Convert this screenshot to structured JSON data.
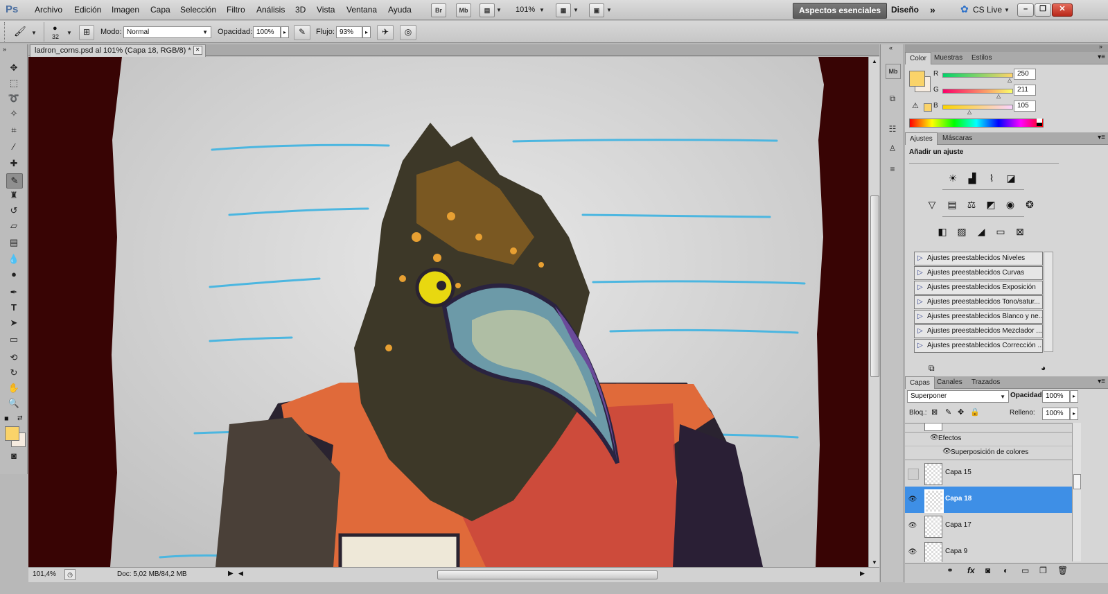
{
  "app": {
    "logo": "Ps"
  },
  "menu": [
    "Archivo",
    "Edición",
    "Imagen",
    "Capa",
    "Selección",
    "Filtro",
    "Análisis",
    "3D",
    "Vista",
    "Ventana",
    "Ayuda"
  ],
  "menubar": {
    "bridge": "Br",
    "minibridge": "Mb",
    "zoom": "101%",
    "workspace_active": "Aspectos esenciales",
    "workspace_other": "Diseño",
    "cs_live": "CS Live"
  },
  "options": {
    "brush_size": "32",
    "mode_label": "Modo:",
    "mode_value": "Normal",
    "opacity_label": "Opacidad:",
    "opacity_value": "100%",
    "flow_label": "Flujo:",
    "flow_value": "93%"
  },
  "document": {
    "tab_title": "ladron_corns.psd al 101% (Capa 18, RGB/8) *",
    "status_zoom": "101,4%",
    "status_doc": "Doc: 5,02 MB/84,2 MB"
  },
  "color_panel": {
    "tabs": [
      "Color",
      "Muestras",
      "Estilos"
    ],
    "fg_color": "#fad369",
    "channels": [
      {
        "label": "R",
        "value": "250"
      },
      {
        "label": "G",
        "value": "211"
      },
      {
        "label": "B",
        "value": "105"
      }
    ]
  },
  "adjustments_panel": {
    "tabs": [
      "Ajustes",
      "Máscaras"
    ],
    "title": "Añadir un ajuste",
    "presets": [
      "Ajustes preestablecidos Niveles",
      "Ajustes preestablecidos Curvas",
      "Ajustes preestablecidos Exposición",
      "Ajustes preestablecidos Tono/satur...",
      "Ajustes preestablecidos Blanco y ne...",
      "Ajustes preestablecidos Mezclador ...",
      "Ajustes preestablecidos Corrección ..."
    ]
  },
  "layers_panel": {
    "tabs": [
      "Capas",
      "Canales",
      "Trazados"
    ],
    "blend_mode": "Superponer",
    "opacity_label": "Opacidad:",
    "opacity_value": "100%",
    "lock_label": "Bloq.:",
    "fill_label": "Relleno:",
    "fill_value": "100%",
    "effects_label": "Efectos",
    "effect_item": "Superposición de colores",
    "layers": [
      {
        "name": "Capa 15",
        "visible": false,
        "selected": false
      },
      {
        "name": "Capa 18",
        "visible": true,
        "selected": true
      },
      {
        "name": "Capa 17",
        "visible": true,
        "selected": false
      },
      {
        "name": "Capa 9",
        "visible": true,
        "selected": false
      }
    ]
  }
}
